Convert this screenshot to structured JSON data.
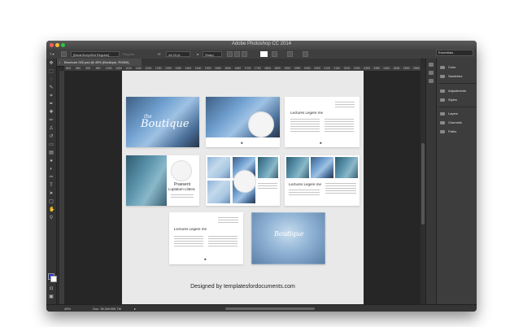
{
  "window": {
    "title": "Adobe Photoshop CC 2014"
  },
  "options_bar": {
    "font_family": "[BrushScriptStd Regular]",
    "font_style": "Regular",
    "font_size": "44,03 pt",
    "anti_alias": "Sharp",
    "workspace": "Essentials"
  },
  "document_tab": {
    "label": "Brochure 002.psd @ 45% (Boutique, RGB/8)"
  },
  "ruler": {
    "ticks": [
      "800",
      "850",
      "900",
      "950",
      "1000",
      "1050",
      "1100",
      "1150",
      "1200",
      "1250",
      "1300",
      "1350",
      "1400",
      "1450",
      "1500",
      "1550",
      "1600",
      "1650",
      "1700",
      "1750",
      "1800",
      "1850",
      "1900",
      "1950",
      "2000",
      "2050",
      "2100",
      "2150",
      "2200",
      "2250",
      "2300",
      "2350",
      "2400",
      "2450",
      "2500",
      "2550"
    ]
  },
  "panels": {
    "items": [
      {
        "label": "Color",
        "icon": "color-icon"
      },
      {
        "label": "Swatches",
        "icon": "swatches-icon"
      },
      {
        "label": "Adjustments",
        "icon": "adjustments-icon"
      },
      {
        "label": "Styles",
        "icon": "styles-icon"
      },
      {
        "label": "Layers",
        "icon": "layers-icon"
      },
      {
        "label": "Channels",
        "icon": "channels-icon"
      },
      {
        "label": "Paths",
        "icon": "paths-icon"
      }
    ]
  },
  "status": {
    "zoom": "45%",
    "doc_size": "Doc: 35,0M/405,7M"
  },
  "canvas": {
    "brand_text": "Boutique",
    "brand_script": "the",
    "present_line1": "Praesent",
    "present_line2": "Luptatum Littera",
    "heading": "Lectures Legere me",
    "credit": "Designed by templatesfordocuments.com"
  },
  "colors": {
    "foreground": "#1e36c8",
    "background": "#ffffff",
    "page": "#e9e9e9",
    "canvas_bg": "#262626"
  }
}
